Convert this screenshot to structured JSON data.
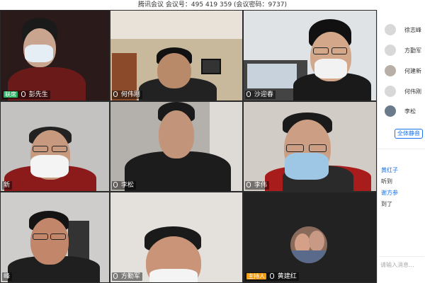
{
  "meeting": {
    "title": "腾讯会议  会议号：495 419 359  (会议密码：9737)"
  },
  "tiles": [
    {
      "name": "彭先生",
      "role_label": "联席",
      "bg": "#2b1a1a"
    },
    {
      "name": "何伟刚",
      "bg": "#7a6a58"
    },
    {
      "name": "沙迎春",
      "bg": "#4a5a6a"
    },
    {
      "name": "新",
      "bg": "#8a8888"
    },
    {
      "name": "李松",
      "bg": "#a9a6a0"
    },
    {
      "name": "李伟",
      "bg": "#8e8a86"
    },
    {
      "name": "峰",
      "bg": "#9c9a98"
    },
    {
      "name": "方勤军",
      "bg": "#d8d4d0"
    },
    {
      "name": "黄建红",
      "role_label": "主持人",
      "bg": "#222222"
    }
  ],
  "participants": [
    {
      "name": "徐志峰"
    },
    {
      "name": "方勤军"
    },
    {
      "name": "何建新"
    },
    {
      "name": "何伟刚"
    },
    {
      "name": "李松"
    }
  ],
  "mute_all_label": "全体静音",
  "chat": [
    {
      "sender": "黄红子",
      "text": "听到"
    },
    {
      "sender": "谢方参",
      "text": "到了"
    }
  ],
  "chat_placeholder": "请输入消息..."
}
